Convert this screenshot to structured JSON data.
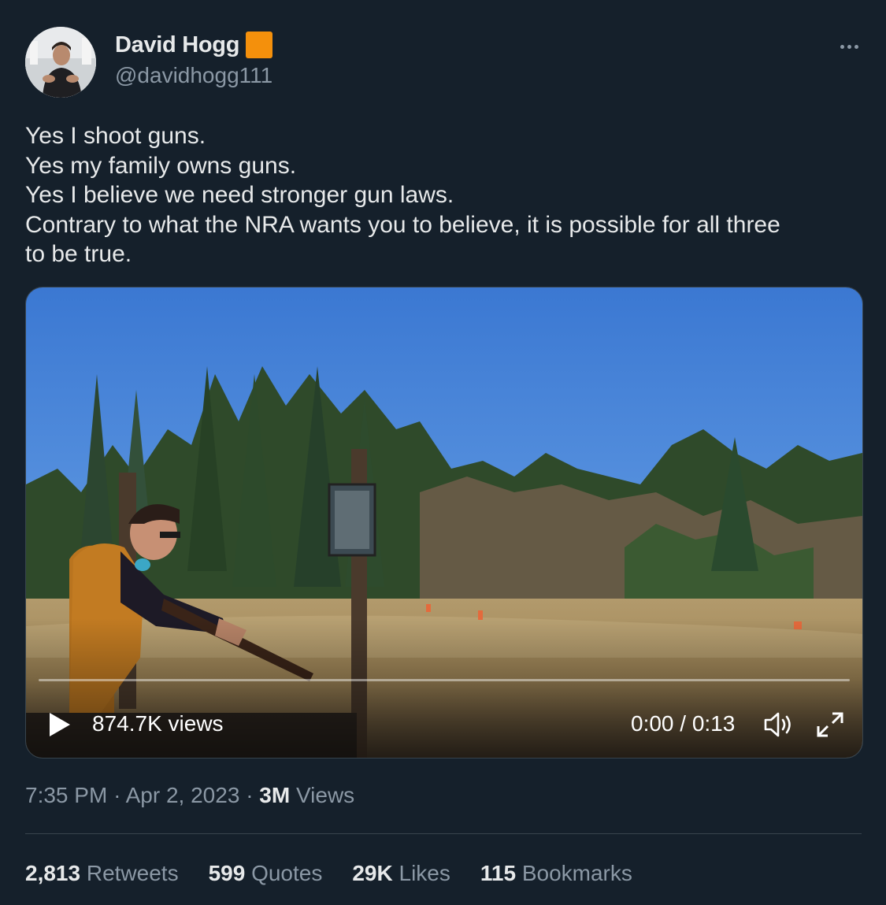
{
  "author": {
    "display_name": "David Hogg",
    "handle": "@davidhogg111",
    "badge_color": "#f4900c"
  },
  "tweet": {
    "lines": [
      "Yes I shoot guns.",
      "Yes my family owns guns.",
      "Yes I believe we need stronger gun laws.",
      "Contrary to what the NRA wants you to believe, it is possible for all three",
      "to be true."
    ]
  },
  "video": {
    "views_label": "874.7K views",
    "time_current": "0:00",
    "time_total": "0:13",
    "time_label": "0:00 / 0:13",
    "progress": 0,
    "icons": [
      "play-icon",
      "volume-icon",
      "fullscreen-icon"
    ]
  },
  "meta": {
    "time": "7:35 PM",
    "separator": "·",
    "date": "Apr 2, 2023",
    "views_count": "3M",
    "views_label": "Views"
  },
  "stats": [
    {
      "count": "2,813",
      "label": "Retweets"
    },
    {
      "count": "599",
      "label": "Quotes"
    },
    {
      "count": "29K",
      "label": "Likes"
    },
    {
      "count": "115",
      "label": "Bookmarks"
    }
  ],
  "icons": {
    "more": "more-icon",
    "badge": "verified-badge-icon"
  },
  "colors": {
    "background": "#15202b",
    "text": "#e7e9ea",
    "secondary": "#8b98a5",
    "border": "#38444d"
  }
}
